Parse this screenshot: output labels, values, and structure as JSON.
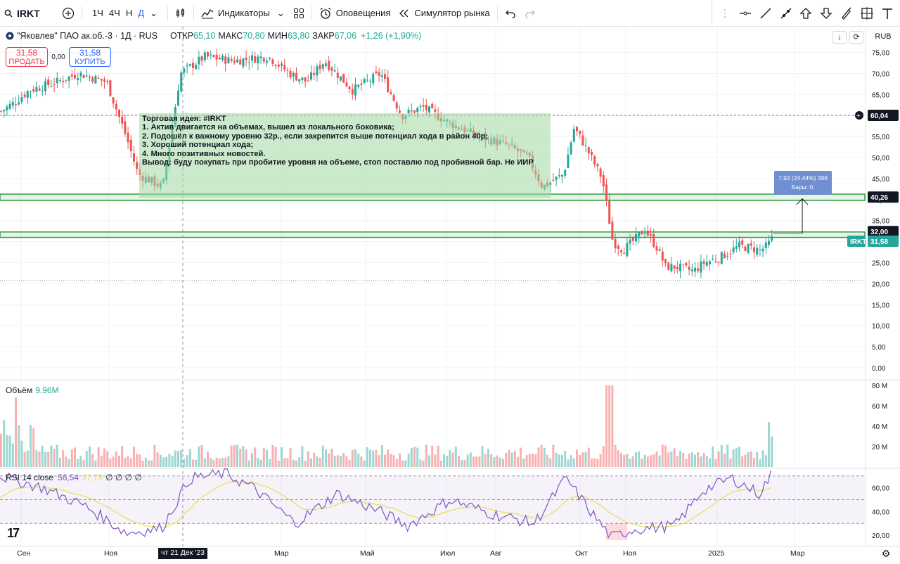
{
  "toolbar": {
    "symbol": "IRKT",
    "intervals": [
      "1Ч",
      "4Ч",
      "Н",
      "Д"
    ],
    "active_interval": "Д",
    "indicators": "Индикаторы",
    "alerts": "Оповещения",
    "replay": "Симулятор рынка"
  },
  "legend": {
    "name": "\"Яковлев\" ПАО ак.об.-3 · 1Д · RUS",
    "open_label": "ОТКР",
    "open": "65,10",
    "high_label": "МАКС",
    "high": "70,80",
    "low_label": "МИН",
    "low": "63,80",
    "close_label": "ЗАКР",
    "close": "67,06",
    "change": "+1,26 (+1,90%)"
  },
  "trade": {
    "sell_price": "31,58",
    "sell_label": "ПРОДАТЬ",
    "spread": "0,00",
    "buy_price": "31,58",
    "buy_label": "КУПИТЬ"
  },
  "idea_text": [
    "Торговая идея: #IRKT",
    "1. Актив двигается на объемах, вышел из локального боковика;",
    "2. Подошёл к важному уровню 32р., если закрепится выше потенциал хода в район 40р;",
    "3. Хороший потенциал хода;",
    "4. Много позитивных новостей.",
    "Вывод: буду покупать при пробитие уровня на объеме, стоп поставлю под пробивной бар. Не ИИР"
  ],
  "measure": {
    "line1": "7,92 (24,44%) 396",
    "line2": "Бары: 0,"
  },
  "price_scale": {
    "currency": "RUB",
    "ticks": [
      "75,00",
      "70,00",
      "65,00",
      "60,00",
      "55,00",
      "50,00",
      "45,00",
      "40,00",
      "35,00",
      "30,00",
      "25,00",
      "20,00",
      "15,00",
      "10,00",
      "5,00",
      "0,00"
    ],
    "label_top_line": "60,04",
    "label_resist": "40,26",
    "label_support": "32,00",
    "label_symbol": "IRKT",
    "label_last": "31,58"
  },
  "volume": {
    "label": "Объём",
    "value": "9,96M",
    "ticks": [
      "80 M",
      "60 M",
      "40 M",
      "20 M"
    ]
  },
  "rsi": {
    "label": "RSI 14 close",
    "value": "56,54",
    "ma_value": "37,79",
    "extra": "∅ ∅ ∅ ∅",
    "ticks": [
      "60,00",
      "40,00",
      "20,00"
    ]
  },
  "time_axis": {
    "labels": [
      "Сен",
      "Ноя",
      "Мар",
      "Май",
      "Июл",
      "Авг",
      "Окт",
      "Ноя",
      "2025",
      "Мар"
    ],
    "cursor_label": "чт 21 Дек '23"
  },
  "colors": {
    "up": "#26a69a",
    "down": "#ef5350",
    "zone": "#2e9e3e",
    "rsi": "#7e57c2",
    "rsi_ma": "#e8e060"
  },
  "chart_data": {
    "type": "candlestick",
    "currency": "RUB",
    "ylim": [
      0,
      78
    ],
    "levels": [
      60.04,
      40.26,
      32.0
    ],
    "last_price": 31.58,
    "x_labels": [
      "Сен",
      "Ноя",
      "Мар",
      "Май",
      "Июл",
      "Авг",
      "Окт",
      "Ноя",
      "2025",
      "Мар"
    ],
    "close_path_approx": [
      [
        "Сен",
        60
      ],
      [
        "Ноя",
        66
      ],
      [
        "Дек",
        46
      ],
      [
        "Фев",
        68
      ],
      [
        "Мар",
        74
      ],
      [
        "Апр",
        71
      ],
      [
        "Май",
        67
      ],
      [
        "Июн",
        62
      ],
      [
        "Июл",
        58
      ],
      [
        "Авг",
        50
      ],
      [
        "Сен",
        44
      ],
      [
        "Окт",
        57
      ],
      [
        "Окт",
        45
      ],
      [
        "Ноя",
        29
      ],
      [
        "Ноя",
        32
      ],
      [
        "Дек",
        24
      ],
      [
        "Янв",
        26
      ],
      [
        "Фев",
        29
      ],
      [
        "Фев",
        28
      ],
      [
        "Мар",
        31.58
      ]
    ],
    "volume_ylim": [
      0,
      80
    ],
    "volume_last": "9,96M",
    "rsi_ylim": [
      15,
      75
    ],
    "rsi_bands": [
      70,
      50,
      30
    ],
    "rsi_last": 56.54,
    "rsi_ma_last": 37.79
  }
}
